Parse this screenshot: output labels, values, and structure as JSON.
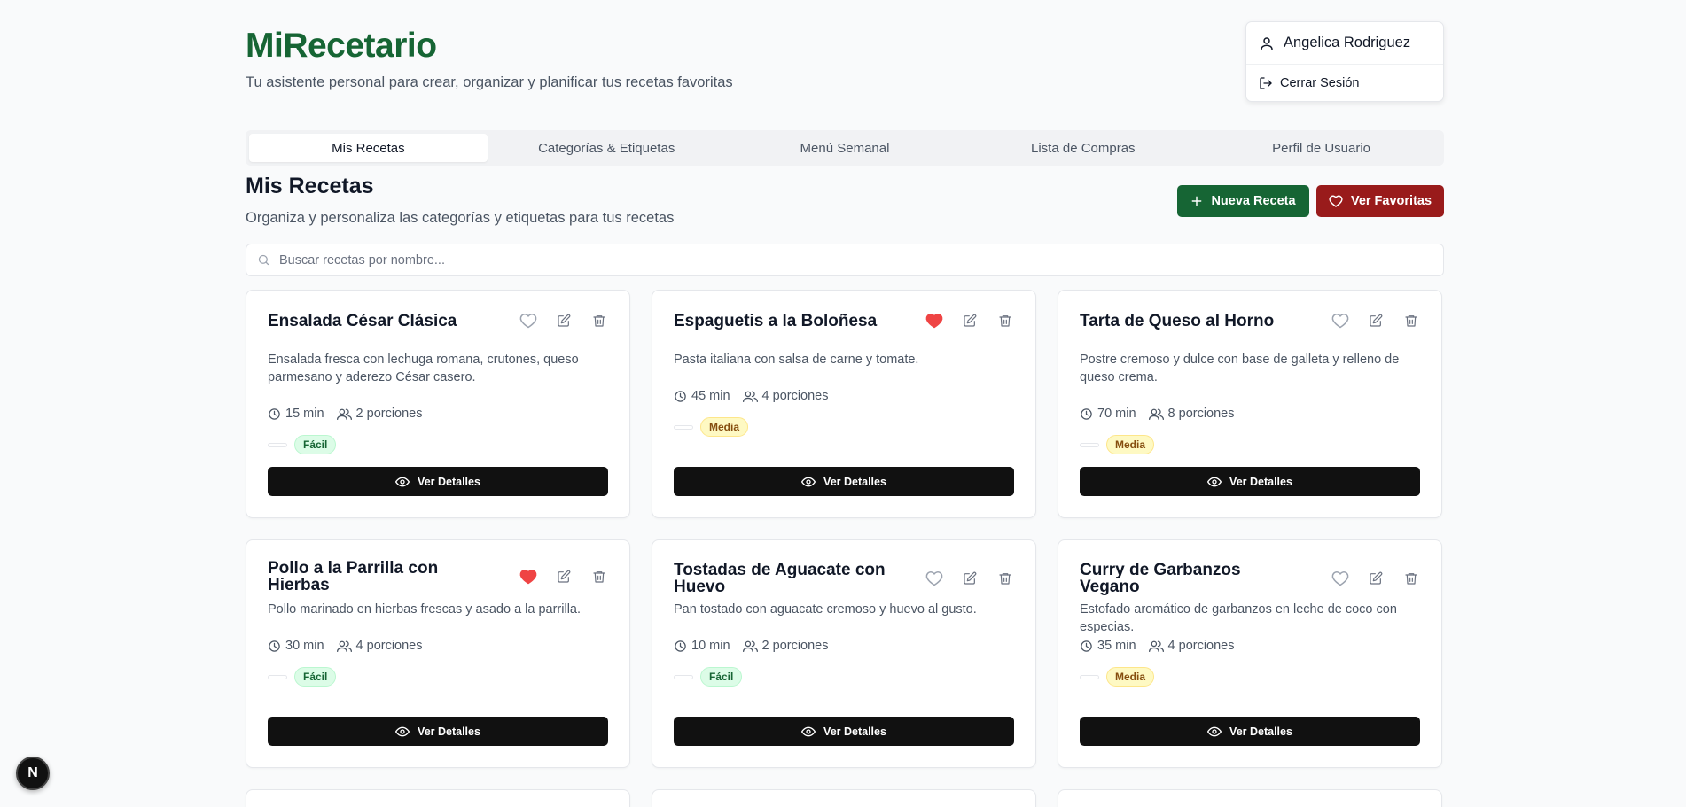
{
  "header": {
    "title": "MiRecetario",
    "subtitle": "Tu asistente personal para crear, organizar y planificar tus recetas favoritas"
  },
  "user_menu": {
    "name": "Angelica Rodriguez",
    "logout_label": "Cerrar Sesión"
  },
  "tabs": [
    {
      "label": "Mis Recetas",
      "active": true
    },
    {
      "label": "Categorías & Etiquetas",
      "active": false
    },
    {
      "label": "Menú Semanal",
      "active": false
    },
    {
      "label": "Lista de Compras",
      "active": false
    },
    {
      "label": "Perfil de Usuario",
      "active": false
    }
  ],
  "section": {
    "title": "Mis Recetas",
    "subtitle": "Organiza y personaliza las categorías y etiquetas para tus recetas",
    "new_button": "Nueva Receta",
    "fav_button": "Ver Favoritas"
  },
  "search": {
    "placeholder": "Buscar recetas por nombre...",
    "value": ""
  },
  "recipes": [
    {
      "title": "Ensalada César Clásica",
      "description": "Ensalada fresca con lechuga romana, crutones, queso parmesano y aderezo César casero.",
      "time": "15 min",
      "servings": "2 porciones",
      "difficulty": "Fácil",
      "favorite": false,
      "details_label": "Ver Detalles"
    },
    {
      "title": "Espaguetis a la Boloñesa",
      "description": "Pasta italiana con salsa de carne y tomate.",
      "time": "45 min",
      "servings": "4 porciones",
      "difficulty": "Media",
      "favorite": true,
      "details_label": "Ver Detalles"
    },
    {
      "title": "Tarta de Queso al Horno",
      "description": "Postre cremoso y dulce con base de galleta y relleno de queso crema.",
      "time": "70 min",
      "servings": "8 porciones",
      "difficulty": "Media",
      "favorite": false,
      "details_label": "Ver Detalles"
    },
    {
      "title": "Pollo a la Parrilla con Hierbas",
      "description": "Pollo marinado en hierbas frescas y asado a la parrilla.",
      "time": "30 min",
      "servings": "4 porciones",
      "difficulty": "Fácil",
      "favorite": true,
      "details_label": "Ver Detalles"
    },
    {
      "title": "Tostadas de Aguacate con Huevo",
      "description": "Pan tostado con aguacate cremoso y huevo al gusto.",
      "time": "10 min",
      "servings": "2 porciones",
      "difficulty": "Fácil",
      "favorite": false,
      "details_label": "Ver Detalles"
    },
    {
      "title": "Curry de Garbanzos Vegano",
      "description": "Estofado aromático de garbanzos en leche de coco con especias.",
      "time": "35 min",
      "servings": "4 porciones",
      "difficulty": "Media",
      "favorite": false,
      "details_label": "Ver Detalles"
    }
  ],
  "dev_badge": "N",
  "colors": {
    "brand_green": "#166534",
    "fav_red": "#991b1b",
    "heart_red": "#ef4444"
  }
}
